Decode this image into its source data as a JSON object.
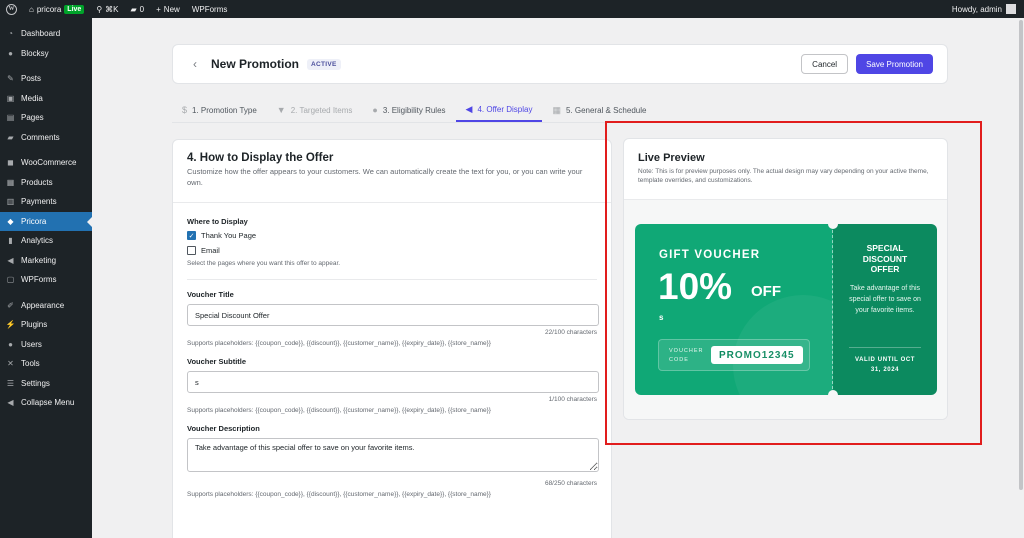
{
  "admin_bar": {
    "site_name": "pricora",
    "live_badge": "Live",
    "shortcut": "⌘K",
    "comments_count": "0",
    "new_label": "New",
    "wpforms_label": "WPForms",
    "greeting": "Howdy, admin"
  },
  "sidebar": {
    "items": [
      {
        "label": "Dashboard",
        "icon": "dashboard-icon"
      },
      {
        "label": "Blocksy",
        "icon": "blocksy-icon"
      },
      {
        "label": "Posts",
        "icon": "pin-icon"
      },
      {
        "label": "Media",
        "icon": "media-icon"
      },
      {
        "label": "Pages",
        "icon": "page-icon"
      },
      {
        "label": "Comments",
        "icon": "comment-icon"
      },
      {
        "label": "WooCommerce",
        "icon": "woocommerce-icon"
      },
      {
        "label": "Products",
        "icon": "archive-icon"
      },
      {
        "label": "Payments",
        "icon": "payments-icon"
      },
      {
        "label": "Pricora",
        "icon": "pricora-icon"
      },
      {
        "label": "Analytics",
        "icon": "bar-chart-icon"
      },
      {
        "label": "Marketing",
        "icon": "megaphone-icon"
      },
      {
        "label": "WPForms",
        "icon": "forms-icon"
      },
      {
        "label": "Appearance",
        "icon": "brush-icon"
      },
      {
        "label": "Plugins",
        "icon": "plug-icon"
      },
      {
        "label": "Users",
        "icon": "users-icon"
      },
      {
        "label": "Tools",
        "icon": "wrench-icon"
      },
      {
        "label": "Settings",
        "icon": "settings-icon"
      },
      {
        "label": "Collapse Menu",
        "icon": "collapse-icon"
      }
    ]
  },
  "header": {
    "back_icon": "chevron-left-icon",
    "title": "New Promotion",
    "status": "ACTIVE",
    "cancel_label": "Cancel",
    "save_label": "Save Promotion"
  },
  "tabs": [
    {
      "label": "1. Promotion Type",
      "icon": "dollar-circle-icon"
    },
    {
      "label": "2. Targeted Items",
      "icon": "filter-icon"
    },
    {
      "label": "3. Eligibility Rules",
      "icon": "user-icon"
    },
    {
      "label": "4. Offer Display",
      "icon": "megaphone-icon"
    },
    {
      "label": "5. General & Schedule",
      "icon": "calendar-icon"
    }
  ],
  "form": {
    "title": "4. How to Display the Offer",
    "description": "Customize how the offer appears to your customers. We can automatically create the text for you, or you can write your own.",
    "where_label": "Where to Display",
    "options": [
      {
        "label": "Thank You Page",
        "checked": true
      },
      {
        "label": "Email",
        "checked": false
      }
    ],
    "where_hint": "Select the pages where you want this offer to appear.",
    "voucher_title_label": "Voucher Title",
    "voucher_title_value": "Special Discount Offer",
    "voucher_title_counter": "22/100 characters",
    "voucher_subtitle_label": "Voucher Subtitle",
    "voucher_subtitle_value": "s",
    "voucher_subtitle_counter": "1/100 characters",
    "voucher_description_label": "Voucher Description",
    "voucher_description_value": "Take advantage of this special offer to save on your favorite items.",
    "voucher_description_counter": "68/250 characters",
    "placeholders_hint": "Supports placeholders: {{coupon_code}}, {{discount}}, {{customer_name}}, {{expiry_date}}, {{store_name}}"
  },
  "preview": {
    "title": "Live Preview",
    "note": "Note: This is for preview purposes only. The actual design may vary depending on your active theme, template overrides, and customizations.",
    "voucher": {
      "kicker": "GIFT VOUCHER",
      "amount": "10%",
      "amount_suffix": "OFF",
      "subtitle": "s",
      "code_label": "VOUCHER CODE",
      "code": "PROMO12345",
      "side_title": "SPECIAL DISCOUNT OFFER",
      "side_description": "Take advantage of this special offer to save on your favorite items.",
      "valid_until": "VALID UNTIL OCT 31, 2024"
    }
  },
  "colors": {
    "accent": "#4f46e5",
    "wp_blue": "#2271b1",
    "voucher_green": "#10a876",
    "voucher_dark_green": "#0c8a5f",
    "highlight_red": "#e11d1d"
  }
}
